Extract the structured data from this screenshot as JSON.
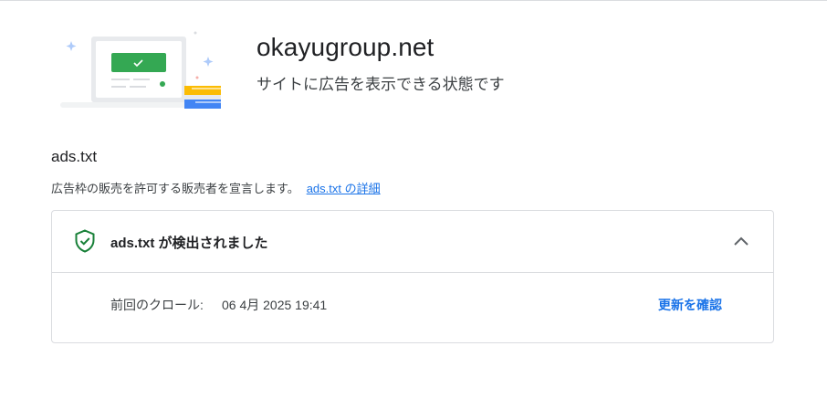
{
  "header": {
    "site_name": "okayugroup.net",
    "status_text": "サイトに広告を表示できる状態です",
    "illustration": "browser-window-with-checkmark",
    "colors": {
      "green": "#34a853",
      "blue": "#4285f4",
      "yellow": "#fbbc04"
    }
  },
  "ads_txt": {
    "title": "ads.txt",
    "description": "広告枠の販売を許可する販売者を宣言します。",
    "details_link": "ads.txt の詳細"
  },
  "card": {
    "status_icon": "shield-check-icon",
    "status_title": "ads.txt が検出されました",
    "expand_icon": "chevron-up-icon",
    "crawl_label": "前回のクロール:",
    "crawl_value": "06 4月 2025 19:41",
    "verify_button": "更新を確認"
  }
}
